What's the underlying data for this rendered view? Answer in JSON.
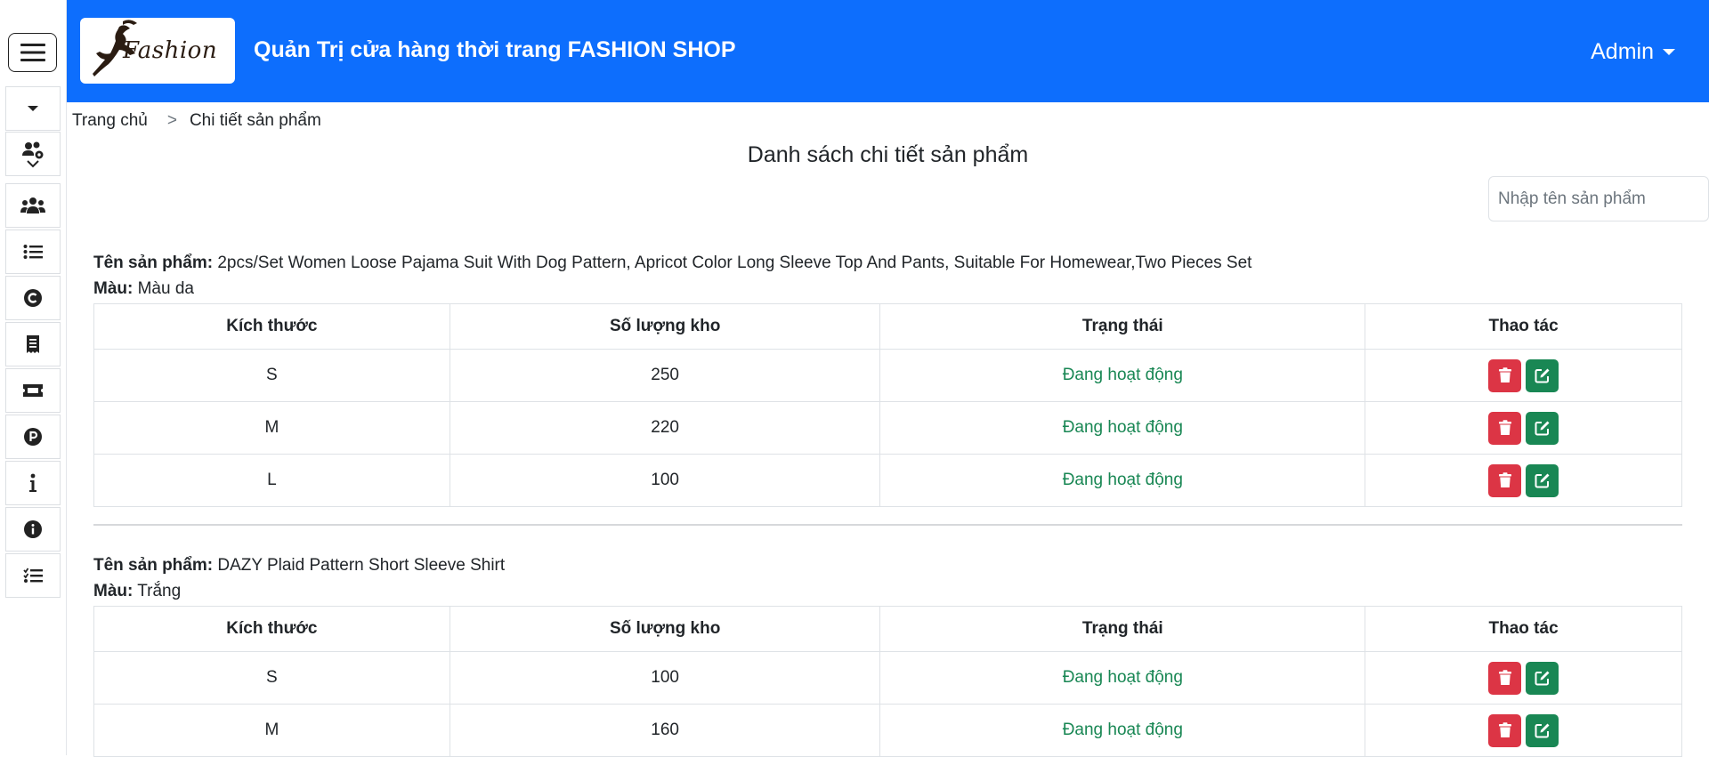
{
  "header": {
    "logo_text": "Fashion",
    "title": "Quản Trị cửa hàng thời trang FASHION SHOP",
    "admin_label": "Admin"
  },
  "sidebar": {
    "items": [
      {
        "icon": "caret-down-icon"
      },
      {
        "icon": "users-gear-icon"
      },
      {
        "icon": "users-icon"
      },
      {
        "icon": "list-icon"
      },
      {
        "icon": "copyright-icon"
      },
      {
        "icon": "receipt-icon"
      },
      {
        "icon": "ticket-icon"
      },
      {
        "icon": "parking-icon"
      },
      {
        "icon": "info-icon"
      },
      {
        "icon": "info-circle-icon"
      },
      {
        "icon": "list-check-icon"
      }
    ]
  },
  "breadcrumb": {
    "home": "Trang chủ",
    "separator": ">",
    "current": "Chi tiết sản phẩm"
  },
  "page_title": "Danh sách chi tiết sản phẩm",
  "search": {
    "placeholder": "Nhập tên sản phẩm"
  },
  "labels": {
    "product_name": "Tên sản phẩm:",
    "color": "Màu:"
  },
  "table_headers": {
    "size": "Kích thước",
    "stock": "Số lượng kho",
    "status": "Trạng thái",
    "actions": "Thao tác"
  },
  "products": [
    {
      "name": "2pcs/Set Women Loose Pajama Suit With Dog Pattern, Apricot Color Long Sleeve Top And Pants, Suitable For Homewear,Two Pieces Set",
      "color": "Màu da",
      "rows": [
        {
          "size": "S",
          "stock": "250",
          "status": "Đang hoạt động"
        },
        {
          "size": "M",
          "stock": "220",
          "status": "Đang hoạt động"
        },
        {
          "size": "L",
          "stock": "100",
          "status": "Đang hoạt động"
        }
      ]
    },
    {
      "name": "DAZY Plaid Pattern Short Sleeve Shirt",
      "color": "Trắng",
      "rows": [
        {
          "size": "S",
          "stock": "100",
          "status": "Đang hoạt động"
        },
        {
          "size": "M",
          "stock": "160",
          "status": "Đang hoạt động"
        }
      ]
    }
  ],
  "colors": {
    "primary": "#0d6efd",
    "danger": "#dc3545",
    "success": "#198754"
  }
}
